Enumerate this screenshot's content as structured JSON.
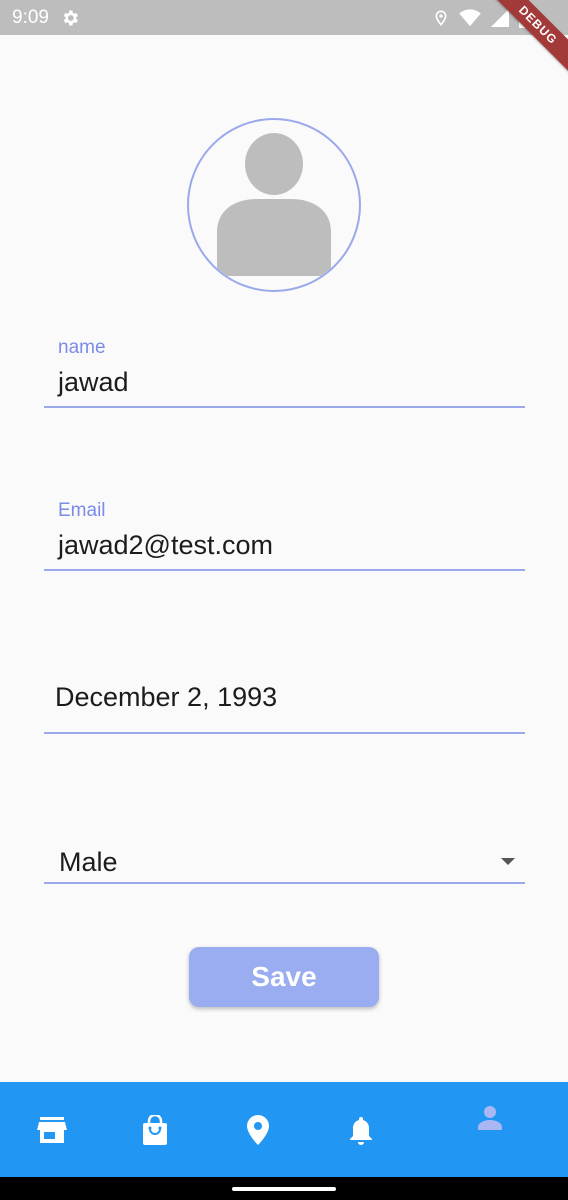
{
  "status_bar": {
    "time": "9:09",
    "icons": [
      "gear-icon",
      "location-icon",
      "wifi-icon",
      "signal-icon",
      "battery-icon"
    ],
    "debug_banner": "DEBUG"
  },
  "avatar": {
    "icon": "person-placeholder-icon"
  },
  "form": {
    "name": {
      "label": "name",
      "value": "jawad"
    },
    "email": {
      "label": "Email",
      "value": "jawad2@test.com"
    },
    "birthdate": {
      "value": "December 2, 1993"
    },
    "gender": {
      "value": "Male",
      "icon": "dropdown-arrow-icon"
    },
    "save_label": "Save"
  },
  "bottom_nav": {
    "items": [
      {
        "icon": "store-icon",
        "active": false
      },
      {
        "icon": "shopping-bag-icon",
        "active": false
      },
      {
        "icon": "location-pin-icon",
        "active": false
      },
      {
        "icon": "notifications-icon",
        "active": false
      },
      {
        "icon": "person-icon",
        "active": true
      }
    ]
  },
  "colors": {
    "accent": "#7b8be8",
    "underline": "#9aa9ec",
    "button": "#9aadf0",
    "nav_background": "#2196f3",
    "active_nav_icon": "#a9b8f5"
  }
}
